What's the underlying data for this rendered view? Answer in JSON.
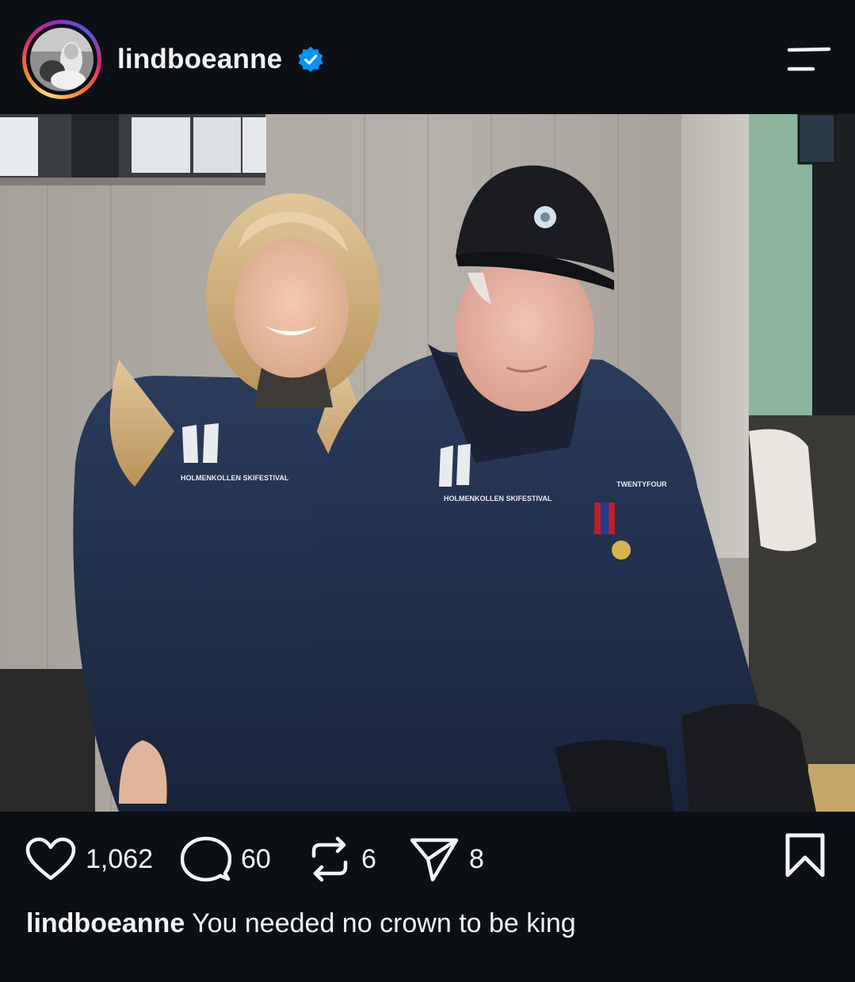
{
  "header": {
    "username": "lindboeanne",
    "verified": true,
    "menu_icon": "menu-icon"
  },
  "post": {
    "image_alt": "Photo of a smiling woman with blonde hair standing next to a seated older man in a black cap; both wear navy Holmenkollen Skifestival jackets",
    "jacket_logo_text": "HOLMENKOLLEN SKIFESTIVAL",
    "jacket_brand_text": "TWENTYFOUR"
  },
  "actions": {
    "likes": "1,062",
    "comments": "60",
    "reposts": "6",
    "shares": "8",
    "like_icon": "heart-icon",
    "comment_icon": "comment-icon",
    "repost_icon": "repost-icon",
    "share_icon": "send-icon",
    "save_icon": "bookmark-icon"
  },
  "caption": {
    "username": "lindboeanne",
    "text": "You needed no crown to be king"
  },
  "colors": {
    "background": "#0c1014",
    "text": "#f5f5f5",
    "verified": "#0095f6",
    "jacket": "#1f2f4a"
  }
}
